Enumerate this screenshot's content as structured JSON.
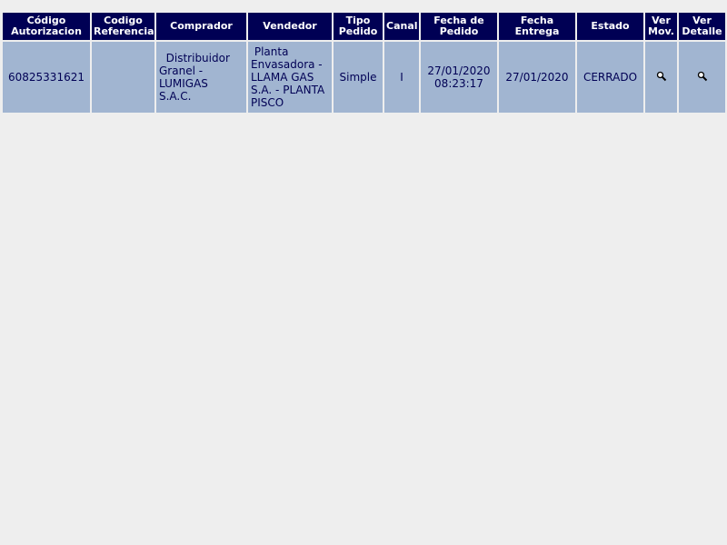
{
  "table": {
    "headers": [
      {
        "name": "codigo-autorizacion",
        "line1": "Código",
        "line2": "Autorizacion"
      },
      {
        "name": "codigo-referencia",
        "line1": "Codigo",
        "line2": "Referencia"
      },
      {
        "name": "comprador",
        "line1": "Comprador",
        "line2": ""
      },
      {
        "name": "vendedor",
        "line1": "Vendedor",
        "line2": ""
      },
      {
        "name": "tipo-pedido",
        "line1": "Tipo",
        "line2": "Pedido"
      },
      {
        "name": "canal",
        "line1": "Canal",
        "line2": ""
      },
      {
        "name": "fecha-pedido",
        "line1": "Fecha de",
        "line2": "Pedido"
      },
      {
        "name": "fecha-entrega",
        "line1": "Fecha",
        "line2": "Entrega"
      },
      {
        "name": "estado",
        "line1": "Estado",
        "line2": ""
      },
      {
        "name": "ver-mov",
        "line1": "Ver",
        "line2": "Mov."
      },
      {
        "name": "ver-detalle",
        "line1": "Ver",
        "line2": "Detalle"
      }
    ],
    "rows": [
      {
        "codigo_autorizacion": "60825331621",
        "codigo_referencia": "",
        "comprador": "  Distribuidor Granel - LUMIGAS S.A.C.",
        "vendedor": " Planta Envasadora -  LLAMA GAS S.A. - PLANTA PISCO",
        "tipo_pedido": "Simple",
        "canal": "I",
        "fecha_pedido": "27/01/2020 08:23:17",
        "fecha_entrega": "27/01/2020",
        "estado": "CERRADO",
        "ver_mov_icon": "magnifier-icon",
        "ver_detalle_icon": "magnifier-icon"
      }
    ]
  },
  "colors": {
    "header_bg": "#000054",
    "header_text": "#ffffff",
    "cell_bg": "#a1b5d1",
    "cell_text": "#000054",
    "page_bg": "#eeeeee"
  }
}
